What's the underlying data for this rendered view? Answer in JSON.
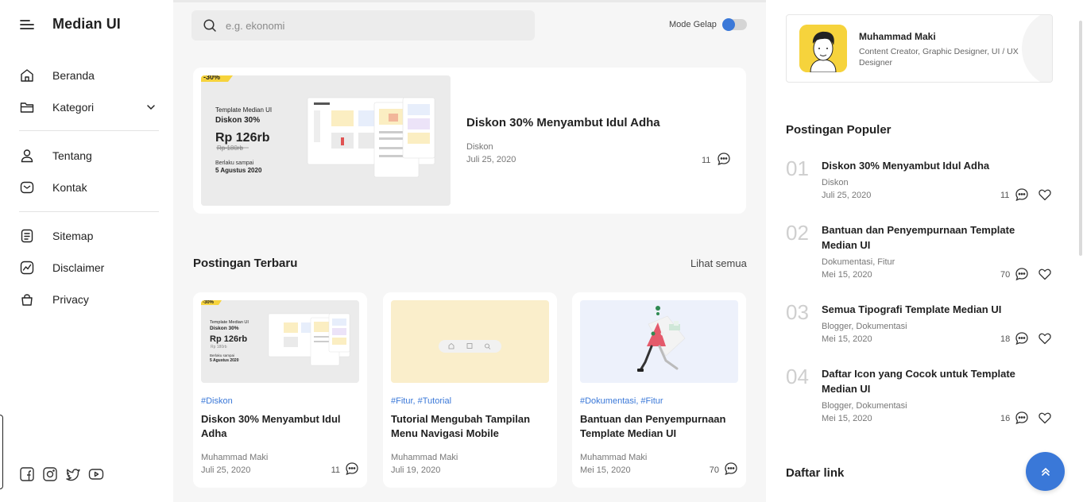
{
  "sidebar": {
    "brand": "Median UI",
    "items": [
      {
        "label": "Beranda",
        "icon": "home-icon"
      },
      {
        "label": "Kategori",
        "icon": "folder-icon"
      },
      {
        "label": "Tentang",
        "icon": "user-icon"
      },
      {
        "label": "Kontak",
        "icon": "mail-icon"
      },
      {
        "label": "Sitemap",
        "icon": "document-icon"
      },
      {
        "label": "Disclaimer",
        "icon": "chart-icon"
      },
      {
        "label": "Privacy",
        "icon": "bag-icon"
      }
    ],
    "socials": [
      "facebook-icon",
      "instagram-icon",
      "twitter-icon",
      "youtube-icon"
    ]
  },
  "header": {
    "search_placeholder": "e.g. ekonomi",
    "dark_mode_label": "Mode Gelap"
  },
  "featured": {
    "title": "Diskon 30% Menyambut Idul Adha",
    "category": "Diskon",
    "date": "Juli 25, 2020",
    "comments": "11",
    "thumb": {
      "badge": "-30%",
      "line1": "Template Median UI",
      "line2": "Diskon 30%",
      "price": "Rp 126rb",
      "old_price": "Rp 180rb",
      "valid_label": "Berlaku sampai",
      "valid_date": "5 Agustus 2020"
    }
  },
  "latest": {
    "title": "Postingan Terbaru",
    "see_all": "Lihat semua",
    "posts": [
      {
        "tags": "#Diskon",
        "title": "Diskon 30% Menyambut Idul Adha",
        "author": "Muhammad Maki",
        "date": "Juli 25, 2020",
        "comments": "11"
      },
      {
        "tags": "#Fitur,  #Tutorial",
        "title": "Tutorial Mengubah Tampilan Menu Navigasi Mobile",
        "author": "Muhammad Maki",
        "date": "Juli 19, 2020",
        "comments": ""
      },
      {
        "tags": "#Dokumentasi,  #Fitur",
        "title": "Bantuan dan Penyempurnaan Template Median UI",
        "author": "Muhammad Maki",
        "date": "Mei 15, 2020",
        "comments": "70"
      }
    ]
  },
  "profile": {
    "name": "Muhammad Maki",
    "role": "Content Creator, Graphic Designer, UI / UX Designer"
  },
  "popular": {
    "title": "Postingan Populer",
    "items": [
      {
        "num": "01",
        "title": "Diskon 30% Menyambut Idul Adha",
        "cats": "Diskon",
        "date": "Juli 25, 2020",
        "comments": "11"
      },
      {
        "num": "02",
        "title": "Bantuan dan Penyempurnaan Template Median UI",
        "cats": "Dokumentasi,  Fitur",
        "date": "Mei 15, 2020",
        "comments": "70"
      },
      {
        "num": "03",
        "title": "Semua Tipografi Template Median UI",
        "cats": "Blogger,  Dokumentasi",
        "date": "Mei 15, 2020",
        "comments": "18"
      },
      {
        "num": "04",
        "title": "Daftar Icon yang Cocok untuk Template Median UI",
        "cats": "Blogger,  Dokumentasi",
        "date": "Mei 15, 2020",
        "comments": "16"
      }
    ]
  },
  "links": {
    "title": "Daftar link"
  },
  "colors": {
    "accent": "#3a78d8",
    "thumb_yellow": "#f6d33c"
  }
}
